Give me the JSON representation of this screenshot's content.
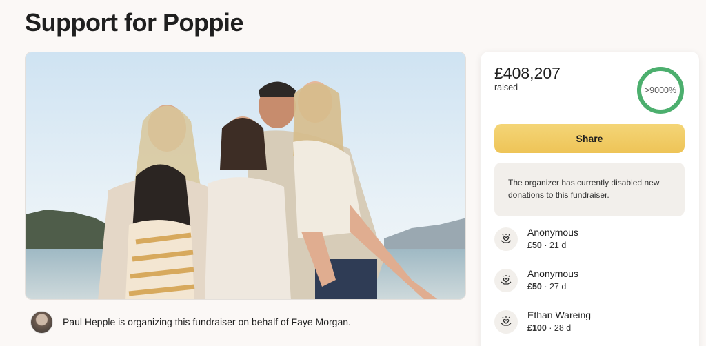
{
  "page": {
    "title": "Support for Poppie"
  },
  "organizer": {
    "text": "Paul Hepple is organizing this fundraiser on behalf of Faye Morgan."
  },
  "stats": {
    "amount": "£408,207",
    "raised_label": "raised",
    "progress_text": ">9000%",
    "progress_fraction": 1.0,
    "ring_color": "#4caf6e"
  },
  "actions": {
    "share_label": "Share"
  },
  "notice": {
    "text": "The organizer has currently disabled new donations to this fundraiser."
  },
  "donations": [
    {
      "name": "Anonymous",
      "amount": "£50",
      "age": "21 d"
    },
    {
      "name": "Anonymous",
      "amount": "£50",
      "age": "27 d"
    },
    {
      "name": "Ethan Wareing",
      "amount": "£100",
      "age": "28 d"
    }
  ],
  "icons": {
    "donor": "heart-hand-icon"
  }
}
